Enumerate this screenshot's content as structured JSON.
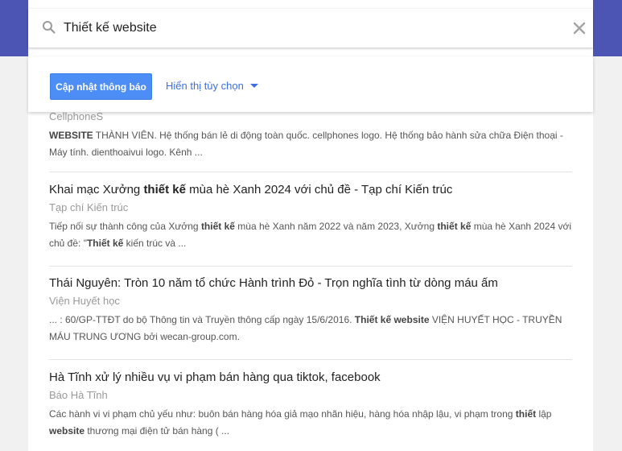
{
  "search": {
    "value": "Thiết kế website",
    "clear_icon": "close-icon"
  },
  "options": {
    "update_label": "Cập nhật thông báo",
    "show_options_label": "Hiển thị tùy chọn"
  },
  "results": [
    {
      "source": "CellphoneS",
      "snippet": [
        {
          "t": "WEBSITE",
          "b": true
        },
        {
          "t": " THÀNH VIÊN. Hệ thống bán lẻ di động toàn quốc. cellphones logo. Hệ thống bảo hành sửa chữa Điện thoại - Máy tính. dienthoaivui logo. Kênh ...",
          "b": false
        }
      ]
    },
    {
      "title": [
        {
          "t": "Khai mạc Xưởng ",
          "b": false
        },
        {
          "t": "thiết kế",
          "b": true
        },
        {
          "t": " mùa hè Xanh 2024 với chủ đề - Tạp chí Kiến trúc",
          "b": false
        }
      ],
      "source": "Tạp chí Kiến trúc",
      "snippet": [
        {
          "t": "Tiếp nối sự thành công của Xưởng ",
          "b": false
        },
        {
          "t": "thiết kế",
          "b": true
        },
        {
          "t": " mùa hè Xanh năm 2022 và năm 2023, Xưởng ",
          "b": false
        },
        {
          "t": "thiết kế",
          "b": true
        },
        {
          "t": " mùa hè Xanh 2024 với chủ đề: \"",
          "b": false
        },
        {
          "t": "Thiết kế",
          "b": true
        },
        {
          "t": " kiến trúc và ...",
          "b": false
        }
      ]
    },
    {
      "title": [
        {
          "t": "Thái Nguyên: Tròn 10 năm tổ chức Hành trình Đỏ - Trọn nghĩa tình từ dòng máu ấm",
          "b": false
        }
      ],
      "source": "Viện Huyết học",
      "snippet": [
        {
          "t": "... : 60/GP-TTĐT do bộ Thông tin và Truyền thông cấp ngày 15/6/2016. ",
          "b": false
        },
        {
          "t": "Thiết kế website",
          "b": true
        },
        {
          "t": " VIỆN HUYẾT HỌC - TRUYỀN MÁU TRUNG ƯƠNG bởi wecan-group.com.",
          "b": false
        }
      ]
    },
    {
      "title": [
        {
          "t": "Hà Tĩnh xử lý nhiều vụ vi phạm bán hàng qua tiktok, facebook",
          "b": false
        }
      ],
      "source": "Báo Hà Tĩnh",
      "snippet": [
        {
          "t": "Các hành vi vi phạm chủ yếu như: buôn bán hàng hóa giả mạo nhãn hiệu, hàng hóa nhập lậu, vi phạm trong ",
          "b": false
        },
        {
          "t": "thiết",
          "b": true
        },
        {
          "t": " lập ",
          "b": false
        },
        {
          "t": "website",
          "b": true
        },
        {
          "t": " thương mại điện tử bán hàng ( ...",
          "b": false
        }
      ]
    }
  ]
}
